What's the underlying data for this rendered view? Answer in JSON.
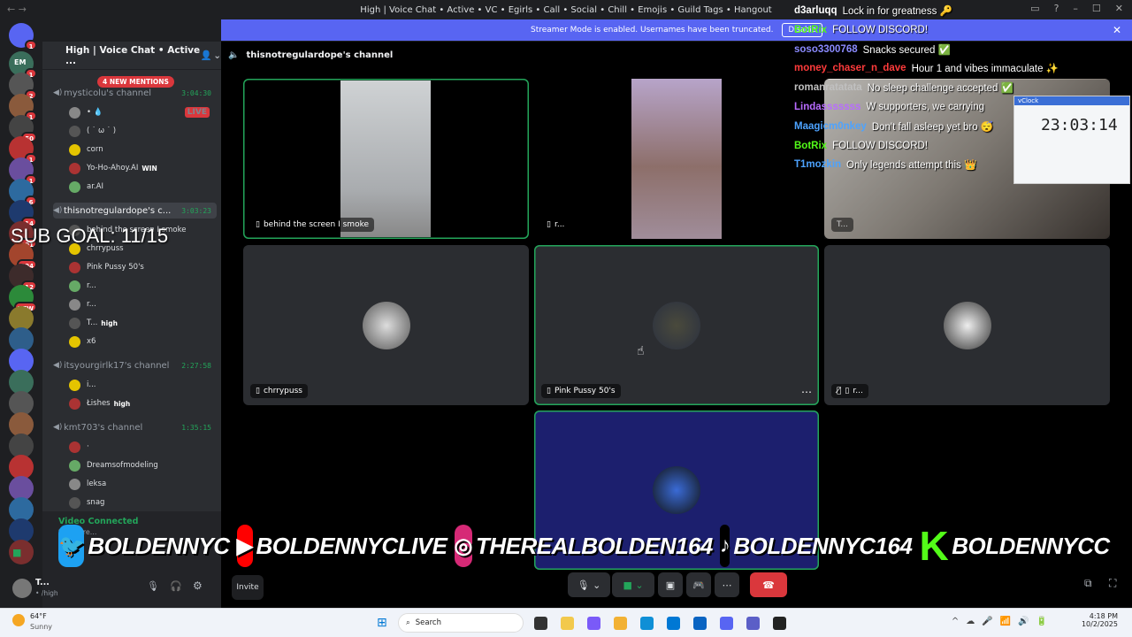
{
  "window": {
    "title": "High | Voice Chat • Active • VC • Egirls • Call • Social • Chill • Emojis • Guild Tags • Hangout"
  },
  "banner": {
    "text": "Streamer Mode is enabled. Usernames have been truncated.",
    "button": "Disable"
  },
  "server": {
    "name": "High | Voice Chat • Active ...",
    "mentions": "4 NEW MENTIONS"
  },
  "rail_badges": [
    "1",
    "1",
    "2",
    "1",
    "50",
    "1",
    "1",
    "6",
    "14",
    "101",
    "294",
    "12",
    "NEW"
  ],
  "rail_em": "EM",
  "channels": [
    {
      "name": "mysticolu's channel",
      "time": "3:04:30",
      "users": [
        {
          "name": "• 💧",
          "tag": "LIVE"
        },
        {
          "name": "( ˙ ω ˙ )"
        },
        {
          "name": "corn"
        },
        {
          "name": "Yo-Ho-Ahoy.AI",
          "tag": "WIN"
        },
        {
          "name": "ar.AI"
        }
      ]
    },
    {
      "name": "thisnotregulardope's c...",
      "time": "3:03:23",
      "users": [
        {
          "name": "behind the screen I smoke"
        },
        {
          "name": "chrrypuss"
        },
        {
          "name": "Pink Pussy 50's"
        },
        {
          "name": "r..."
        },
        {
          "name": "r..."
        },
        {
          "name": "T...",
          "tag": "high"
        },
        {
          "name": "x6"
        }
      ]
    },
    {
      "name": "itsyourgirlk17's channel",
      "time": "2:27:58",
      "users": [
        {
          "name": "i..."
        },
        {
          "name": "Łishes",
          "tag": "high"
        }
      ]
    },
    {
      "name": "kmt703's channel",
      "time": "1:35:15",
      "users": [
        {
          "name": "·"
        },
        {
          "name": "Dreamsofmodeling"
        },
        {
          "name": "leksa"
        },
        {
          "name": "snag"
        }
      ]
    }
  ],
  "sub_goal": "SUB GOAL: 11/15",
  "voice_status": {
    "title": "Video Connected",
    "sub": "thisnotre..."
  },
  "user_panel": {
    "name": "T...",
    "status": "• /high"
  },
  "channel_header": "thisnotregulardope's channel",
  "tiles": [
    {
      "label": "behind the screen I smoke"
    },
    {
      "label": "r..."
    },
    {
      "label": "T..."
    },
    {
      "label": "chrrypuss"
    },
    {
      "label": "Pink Pussy 50's"
    },
    {
      "label": "r..."
    }
  ],
  "chat": [
    {
      "user": "d3arluqq",
      "msg": "Lock in for greatness 🔑",
      "color": "#ffffff"
    },
    {
      "user": "BotRix",
      "msg": "FOLLOW DISCORD!",
      "color": "#53fc18"
    },
    {
      "user": "soso3300768",
      "msg": "Snacks secured ✅",
      "color": "#8b8bff"
    },
    {
      "user": "money_chaser_n_dave",
      "msg": "Hour 1 and vibes immaculate ✨",
      "color": "#ff3b3b"
    },
    {
      "user": "romanratatata",
      "msg": "No sleep challenge accepted ✅",
      "color": "#c0c0c0"
    },
    {
      "user": "Lindasssssss",
      "msg": "W supporters, we carrying",
      "color": "#b86bff"
    },
    {
      "user": "Maagicm0nkey",
      "msg": "Don't fall asleep yet bro 😴",
      "color": "#4da3ff"
    },
    {
      "user": "BotRix",
      "msg": "FOLLOW DISCORD!",
      "color": "#53fc18"
    },
    {
      "user": "T1mozkin",
      "msg": "Only legends attempt this 👑",
      "color": "#4da3ff"
    }
  ],
  "clock": {
    "label": "vClock",
    "time": "23:03:14"
  },
  "socials": [
    {
      "icon": "twitter-icon",
      "handle": "BOLDENNYC",
      "color": "#1da1f2"
    },
    {
      "icon": "youtube-icon",
      "handle": "BOLDENNYCLIVE",
      "color": "#ff0000"
    },
    {
      "icon": "instagram-icon",
      "handle": "THEREALBOLDEN164",
      "color": "#d62976"
    },
    {
      "icon": "tiktok-icon",
      "handle": "BOLDENNYC164",
      "color": "#000000"
    },
    {
      "icon": "kick-icon",
      "handle": "BOLDENNYCC",
      "color": "#53fc18"
    }
  ],
  "invite": "Invite",
  "taskbar": {
    "temp": "64°F",
    "weather": "Sunny",
    "search": "Search",
    "time": "4:18 PM",
    "date": "10/2/2025"
  }
}
